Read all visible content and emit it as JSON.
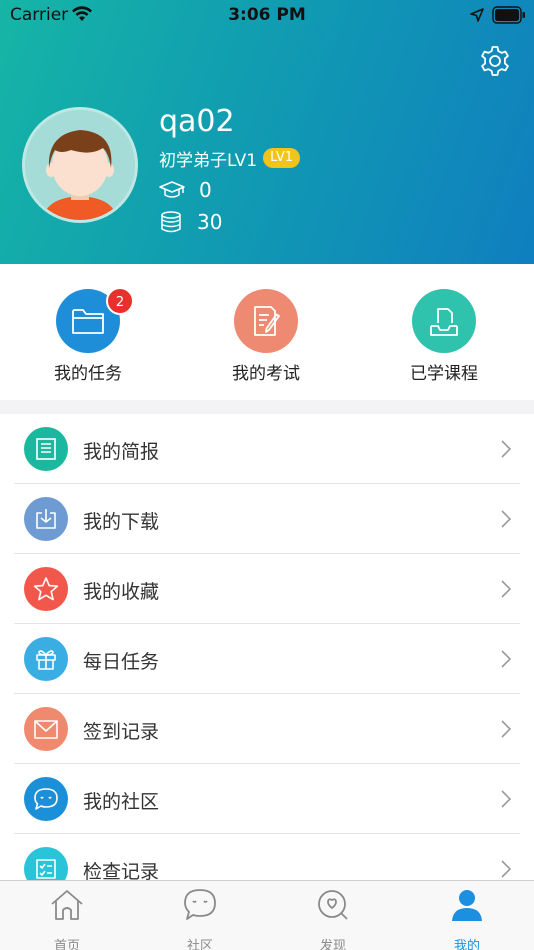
{
  "status_bar": {
    "carrier": "Carrier",
    "time": "3:06 PM"
  },
  "profile": {
    "username": "qa02",
    "level_text": "初学弟子LV1",
    "level_badge": "LV1",
    "courses_count": "0",
    "coins_count": "30"
  },
  "quick_actions": [
    {
      "label": "我的任务",
      "color": "#1f8ed9",
      "badge": "2",
      "icon": "folder-icon"
    },
    {
      "label": "我的考试",
      "color": "#ee8a72",
      "icon": "exam-pencil-icon"
    },
    {
      "label": "已学课程",
      "color": "#2fc2ac",
      "icon": "inbox-tray-icon"
    }
  ],
  "menu": [
    {
      "label": "我的简报",
      "color": "#1bb89f",
      "icon": "report-icon"
    },
    {
      "label": "我的下载",
      "color": "#6f9bd3",
      "icon": "download-icon"
    },
    {
      "label": "我的收藏",
      "color": "#f1574a",
      "icon": "star-icon"
    },
    {
      "label": "每日任务",
      "color": "#3aaee2",
      "icon": "gift-icon"
    },
    {
      "label": "签到记录",
      "color": "#ef8a6f",
      "icon": "envelope-check-icon"
    },
    {
      "label": "我的社区",
      "color": "#1b8fd8",
      "icon": "chat-bubble-icon"
    },
    {
      "label": "检查记录",
      "color": "#29c4d7",
      "icon": "checklist-icon"
    }
  ],
  "tabs": [
    {
      "label": "首页",
      "icon": "home-icon",
      "active": false
    },
    {
      "label": "社区",
      "icon": "community-chat-icon",
      "active": false
    },
    {
      "label": "发现",
      "icon": "discover-icon",
      "active": false
    },
    {
      "label": "我的",
      "icon": "user-icon",
      "active": true
    }
  ],
  "colors": {
    "accent": "#1d8fe0",
    "badge_red": "#e8312d",
    "lv_gold": "#f2c318"
  }
}
